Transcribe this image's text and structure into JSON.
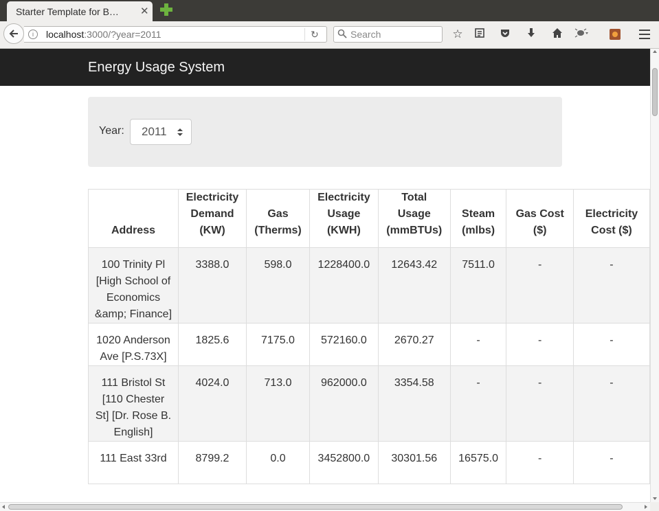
{
  "browser": {
    "tab_title": "Starter Template for B…",
    "tab_close": "✕",
    "url_host": "localhost",
    "url_rest": ":3000/?year=2011",
    "search_placeholder": "Search"
  },
  "site": {
    "brand": "Energy Usage System"
  },
  "filter": {
    "year_label": "Year:",
    "year_value": "2011"
  },
  "table": {
    "headers": [
      "Address",
      "Electricity Demand (KW)",
      "Gas (Therms)",
      "Electricity Usage (KWH)",
      "Total Usage (mmBTUs)",
      "Steam (mlbs)",
      "Gas Cost ($)",
      "Electricity Cost ($)"
    ],
    "rows": [
      [
        "100 Trinity Pl [High School of Economics &amp; Finance]",
        "3388.0",
        "598.0",
        "1228400.0",
        "12643.42",
        "7511.0",
        "-",
        "-"
      ],
      [
        "1020 Anderson Ave [P.S.73X]",
        "1825.6",
        "7175.0",
        "572160.0",
        "2670.27",
        "-",
        "-",
        "-"
      ],
      [
        "111 Bristol St [110 Chester St] [Dr. Rose B. English]",
        "4024.0",
        "713.0",
        "962000.0",
        "3354.58",
        "-",
        "-",
        "-"
      ],
      [
        "111 East 33rd",
        "8799.2",
        "0.0",
        "3452800.0",
        "30301.56",
        "16575.0",
        "-",
        "-"
      ]
    ]
  },
  "colors": {
    "navbar_bg": "#222222",
    "well_bg": "#ececec",
    "striped_row": "#f3f3f3"
  }
}
